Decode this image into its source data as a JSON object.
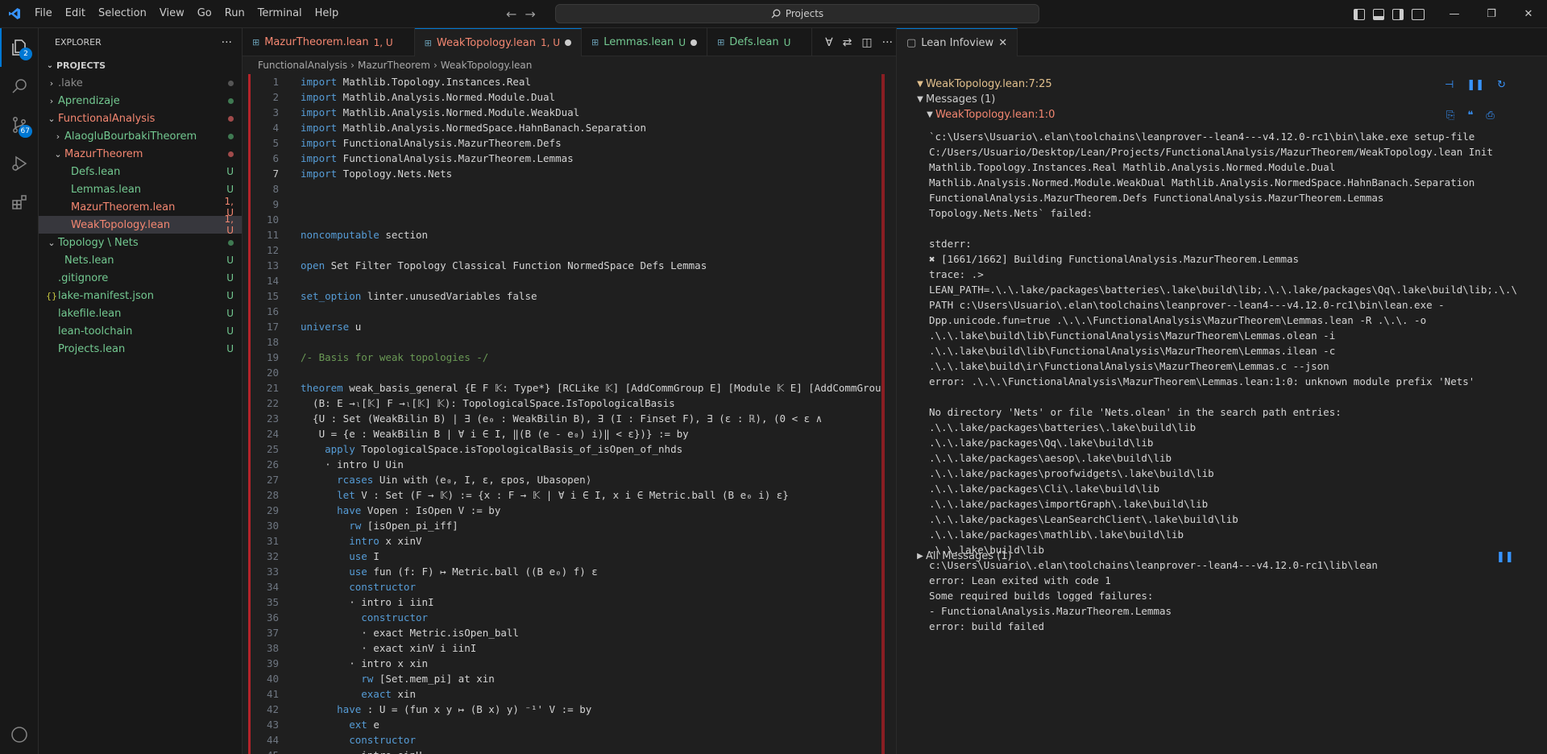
{
  "menubar": {
    "items": [
      "File",
      "Edit",
      "Selection",
      "View",
      "Go",
      "Run",
      "Terminal",
      "Help"
    ]
  },
  "command_center": {
    "label": "Projects",
    "icon": "search-icon"
  },
  "activity_bar": {
    "explorer_badge": "2",
    "scm_badge": "67"
  },
  "sidebar": {
    "title": "EXPLORER",
    "section": "PROJECTS",
    "items": [
      {
        "label": ".lake",
        "indent": 1,
        "folder": true,
        "open": false,
        "color": "gray",
        "deco": "dot-gray"
      },
      {
        "label": "Aprendizaje",
        "indent": 1,
        "folder": true,
        "open": false,
        "color": "g",
        "deco": "dot-green"
      },
      {
        "label": "FunctionalAnalysis",
        "indent": 1,
        "folder": true,
        "open": true,
        "color": "r",
        "deco": "dot-red"
      },
      {
        "label": "AlaogluBourbakiTheorem",
        "indent": 2,
        "folder": true,
        "open": false,
        "color": "g",
        "deco": "dot-green"
      },
      {
        "label": "MazurTheorem",
        "indent": 2,
        "folder": true,
        "open": true,
        "color": "r",
        "deco": "dot-red"
      },
      {
        "label": "Defs.lean",
        "indent": 3,
        "folder": false,
        "color": "g",
        "deco": "U"
      },
      {
        "label": "Lemmas.lean",
        "indent": 3,
        "folder": false,
        "color": "g",
        "deco": "U"
      },
      {
        "label": "MazurTheorem.lean",
        "indent": 3,
        "folder": false,
        "color": "r",
        "deco": "1, U"
      },
      {
        "label": "WeakTopology.lean",
        "indent": 3,
        "folder": false,
        "color": "r",
        "deco": "1, U",
        "selected": true
      },
      {
        "label": "Topology \\ Nets",
        "indent": 1,
        "folder": true,
        "open": true,
        "color": "g",
        "deco": "dot-green"
      },
      {
        "label": "Nets.lean",
        "indent": 2,
        "folder": false,
        "color": "g",
        "deco": "U"
      },
      {
        "label": ".gitignore",
        "indent": 1,
        "folder": false,
        "color": "g",
        "deco": "U"
      },
      {
        "label": "lake-manifest.json",
        "indent": 1,
        "folder": false,
        "color": "g",
        "deco": "U",
        "json": true
      },
      {
        "label": "lakefile.lean",
        "indent": 1,
        "folder": false,
        "color": "g",
        "deco": "U"
      },
      {
        "label": "lean-toolchain",
        "indent": 1,
        "folder": false,
        "color": "g",
        "deco": "U"
      },
      {
        "label": "Projects.lean",
        "indent": 1,
        "folder": false,
        "color": "g",
        "deco": "U"
      }
    ]
  },
  "tabs": [
    {
      "label": "MazurTheorem.lean",
      "status": "1, U",
      "color": "r",
      "active": false,
      "dirty": false
    },
    {
      "label": "WeakTopology.lean",
      "status": "1, U",
      "color": "r",
      "active": true,
      "dirty": true
    },
    {
      "label": "Lemmas.lean",
      "status": "U",
      "color": "g",
      "active": false,
      "dirty": true
    },
    {
      "label": "Defs.lean",
      "status": "U",
      "color": "g",
      "active": false,
      "dirty": false
    }
  ],
  "breadcrumb": [
    "FunctionalAnalysis",
    "MazurTheorem",
    "WeakTopology.lean"
  ],
  "code_lines": [
    "import Mathlib.Topology.Instances.Real",
    "import Mathlib.Analysis.Normed.Module.Dual",
    "import Mathlib.Analysis.Normed.Module.WeakDual",
    "import Mathlib.Analysis.NormedSpace.HahnBanach.Separation",
    "import FunctionalAnalysis.MazurTheorem.Defs",
    "import FunctionalAnalysis.MazurTheorem.Lemmas",
    "import Topology.Nets.Nets",
    "",
    "",
    "",
    "noncomputable section",
    "",
    "open Set Filter Topology Classical Function NormedSpace Defs Lemmas",
    "",
    "set_option linter.unusedVariables false",
    "",
    "universe u",
    "",
    "/- Basis for weak topologies -/",
    "",
    "theorem weak_basis_general {E F 𝕂: Type*} [RCLike 𝕂] [AddCommGroup E] [Module 𝕂 E] [AddCommGrou",
    "  (B: E →ₗ[𝕂] F →ₗ[𝕂] 𝕂): TopologicalSpace.IsTopologicalBasis",
    "  {U : Set (WeakBilin B) | ∃ (e₀ : WeakBilin B), ∃ (I : Finset F), ∃ (ε : ℝ), (0 < ε ∧",
    "   U = {e : WeakBilin B | ∀ i ∈ I, ‖(B (e - e₀) i)‖ < ε})} := by",
    "    apply TopologicalSpace.isTopologicalBasis_of_isOpen_of_nhds",
    "    · intro U Uin",
    "      rcases Uin with ⟨e₀, I, ε, εpos, Ubasopen⟩",
    "      let V : Set (F → 𝕂) := {x : F → 𝕂 | ∀ i ∈ I, x i ∈ Metric.ball (B e₀ i) ε}",
    "      have Vopen : IsOpen V := by",
    "        rw [isOpen_pi_iff]",
    "        intro x xinV",
    "        use I",
    "        use fun (f: F) ↦ Metric.ball ((B e₀) f) ε",
    "        constructor",
    "        · intro i iinI",
    "          constructor",
    "          · exact Metric.isOpen_ball",
    "          · exact xinV i iinI",
    "        · intro x xin",
    "          rw [Set.mem_pi] at xin",
    "          exact xin",
    "      have : U = (fun x y ↦ (B x) y) ⁻¹' V := by",
    "        ext e",
    "        constructor",
    "        · intro einU"
  ],
  "current_line": 7,
  "infoview": {
    "tab_label": "Lean Infoview",
    "location": "WeakTopology.lean:7:25",
    "messages_header": "Messages (1)",
    "message_location": "WeakTopology.lean:1:0",
    "message_text": "`c:\\Users\\Usuario\\.elan\\toolchains\\leanprover--lean4---v4.12.0-rc1\\bin\\lake.exe setup-file\nC:/Users/Usuario/Desktop/Lean/Projects/FunctionalAnalysis/MazurTheorem/WeakTopology.lean Init\nMathlib.Topology.Instances.Real Mathlib.Analysis.Normed.Module.Dual\nMathlib.Analysis.Normed.Module.WeakDual Mathlib.Analysis.NormedSpace.HahnBanach.Separation\nFunctionalAnalysis.MazurTheorem.Defs FunctionalAnalysis.MazurTheorem.Lemmas\nTopology.Nets.Nets` failed:\n\nstderr:\n✖ [1661/1662] Building FunctionalAnalysis.MazurTheorem.Lemmas\ntrace: .>\nLEAN_PATH=.\\.\\.lake/packages\\batteries\\.lake\\build\\lib;.\\.\\.lake/packages\\Qq\\.lake\\build\\lib;.\\.\\\nPATH c:\\Users\\Usuario\\.elan\\toolchains\\leanprover--lean4---v4.12.0-rc1\\bin\\lean.exe -\nDpp.unicode.fun=true .\\.\\.\\FunctionalAnalysis\\MazurTheorem\\Lemmas.lean -R .\\.\\. -o\n.\\.\\.lake\\build\\lib\\FunctionalAnalysis\\MazurTheorem\\Lemmas.olean -i\n.\\.\\.lake\\build\\lib\\FunctionalAnalysis\\MazurTheorem\\Lemmas.ilean -c\n.\\.\\.lake\\build\\ir\\FunctionalAnalysis\\MazurTheorem\\Lemmas.c --json\nerror: .\\.\\.\\FunctionalAnalysis\\MazurTheorem\\Lemmas.lean:1:0: unknown module prefix 'Nets'\n\nNo directory 'Nets' or file 'Nets.olean' in the search path entries:\n.\\.\\.lake/packages\\batteries\\.lake\\build\\lib\n.\\.\\.lake/packages\\Qq\\.lake\\build\\lib\n.\\.\\.lake/packages\\aesop\\.lake\\build\\lib\n.\\.\\.lake/packages\\proofwidgets\\.lake\\build\\lib\n.\\.\\.lake/packages\\Cli\\.lake\\build\\lib\n.\\.\\.lake/packages\\importGraph\\.lake\\build\\lib\n.\\.\\.lake/packages\\LeanSearchClient\\.lake\\build\\lib\n.\\.\\.lake/packages\\mathlib\\.lake\\build\\lib\n.\\.\\.lake\\build\\lib\nc:\\Users\\Usuario\\.elan\\toolchains\\leanprover--lean4---v4.12.0-rc1\\lib\\lean\nerror: Lean exited with code 1\nSome required builds logged failures:\n- FunctionalAnalysis.MazurTheorem.Lemmas\nerror: build failed",
    "all_messages": "All Messages (1)"
  },
  "colors": {
    "accent": "#0078d4",
    "error": "#f48771",
    "added": "#73c991",
    "warning_header": "#e2c08d",
    "keyword": "#569cd6"
  }
}
